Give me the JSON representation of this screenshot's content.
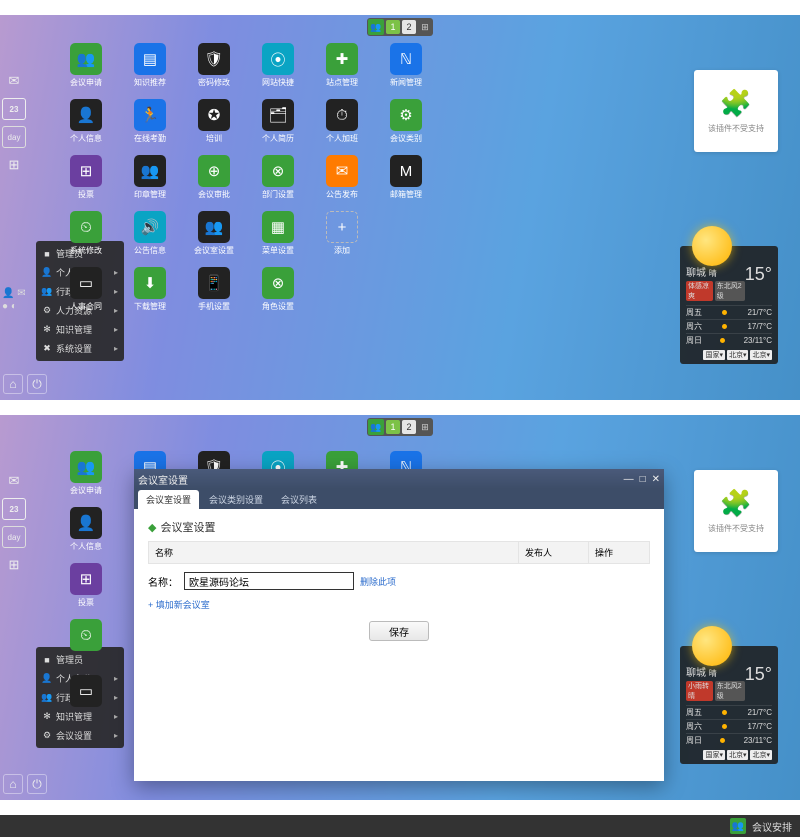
{
  "pager": {
    "pages": [
      "1",
      "2"
    ]
  },
  "sidebar": {
    "calendar": "23",
    "day": "day"
  },
  "startmenu": {
    "items": [
      {
        "icon": "■",
        "label": "管理员",
        "arrow": false
      },
      {
        "icon": "👤",
        "label": "个人办公",
        "arrow": true
      },
      {
        "icon": "👥",
        "label": "行政办公",
        "arrow": true
      },
      {
        "icon": "⚙",
        "label": "人力资源",
        "arrow": true
      },
      {
        "icon": "✻",
        "label": "知识管理",
        "arrow": true
      },
      {
        "icon": "✖",
        "label": "系统设置",
        "arrow": true
      }
    ]
  },
  "startmenu2": {
    "items": [
      {
        "icon": "■",
        "label": "管理员",
        "arrow": false
      },
      {
        "icon": "👤",
        "label": "个人办公",
        "arrow": true
      },
      {
        "icon": "👥",
        "label": "行政办公",
        "arrow": true
      },
      {
        "icon": "✻",
        "label": "知识管理",
        "arrow": true
      },
      {
        "icon": "⚙",
        "label": "会议设置",
        "arrow": true
      }
    ]
  },
  "apps_row1": [
    {
      "c": "c-green",
      "i": "👥",
      "l": "会议申请"
    },
    {
      "c": "c-blue",
      "i": "▤",
      "l": "知识推荐"
    },
    {
      "c": "c-dark",
      "i": "🛡",
      "l": "密码修改"
    },
    {
      "c": "c-teal",
      "i": "⦿",
      "l": "网站快捷"
    },
    {
      "c": "c-green",
      "i": "✚",
      "l": "站点管理"
    },
    {
      "c": "c-blue",
      "i": "ℕ",
      "l": "新闻管理"
    }
  ],
  "apps_row2": [
    {
      "c": "c-dark",
      "i": "👤",
      "l": "个人信息"
    },
    {
      "c": "c-blue",
      "i": "🏃",
      "l": "在线考勤"
    },
    {
      "c": "c-dark",
      "i": "✪",
      "l": "培训"
    },
    {
      "c": "c-dark",
      "i": "🗂",
      "l": "个人简历"
    },
    {
      "c": "c-dark",
      "i": "⏱",
      "l": "个人加班"
    },
    {
      "c": "c-green",
      "i": "⚙",
      "l": "会议类别"
    }
  ],
  "apps_row3": [
    {
      "c": "c-purple",
      "i": "⊞",
      "l": "投票"
    },
    {
      "c": "c-dark",
      "i": "👥",
      "l": "印章管理"
    },
    {
      "c": "c-green",
      "i": "⊕",
      "l": "会议审批"
    },
    {
      "c": "c-green",
      "i": "⊗",
      "l": "部门设置"
    },
    {
      "c": "c-orange",
      "i": "✉",
      "l": "公告发布"
    },
    {
      "c": "c-dark",
      "i": "M",
      "l": "邮箱管理"
    }
  ],
  "apps_row4": [
    {
      "c": "c-green",
      "i": "⏲",
      "l": "系统修改"
    },
    {
      "c": "c-teal",
      "i": "🔊",
      "l": "公告信息"
    },
    {
      "c": "c-dark",
      "i": "👥",
      "l": "会议室设置"
    },
    {
      "c": "c-green",
      "i": "▦",
      "l": "菜单设置"
    },
    {
      "c": "c-border",
      "i": "+",
      "l": "添加"
    }
  ],
  "apps_row5": [
    {
      "c": "c-dark",
      "i": "▭",
      "l": "人事合同"
    },
    {
      "c": "c-green",
      "i": "⬇",
      "l": "下载管理"
    },
    {
      "c": "c-dark",
      "i": "📱",
      "l": "手机设置"
    },
    {
      "c": "c-green",
      "i": "⊗",
      "l": "角色设置"
    }
  ],
  "plugin": {
    "text": "该插件不受支持"
  },
  "weather": {
    "city": "聊城",
    "suffix": "晴",
    "deg": "15°",
    "badge1": "体感凉爽",
    "badge2": "东北风2级",
    "days": [
      {
        "d": "周五",
        "t": "21/7°C"
      },
      {
        "d": "周六",
        "t": "17/7°C"
      },
      {
        "d": "周日",
        "t": "23/11°C"
      }
    ],
    "sel": [
      "国家▾",
      "北京▾",
      "北京▾"
    ]
  },
  "weather2": {
    "badge1": "小雨转晴",
    "badge2": "东北风2级"
  },
  "apps2_r1": [
    {
      "c": "c-green",
      "i": "👥",
      "l": "会议申请"
    },
    {
      "c": "c-blue",
      "i": "▤",
      "l": ""
    },
    {
      "c": "c-dark",
      "i": "🛡",
      "l": ""
    },
    {
      "c": "c-teal",
      "i": "⦿",
      "l": ""
    },
    {
      "c": "c-green",
      "i": "✚",
      "l": ""
    },
    {
      "c": "c-blue",
      "i": "ℕ",
      "l": ""
    }
  ],
  "apps2_r2": [
    {
      "c": "c-dark",
      "i": "👤",
      "l": "个人信息"
    },
    {
      "c": "c-blue",
      "i": "🏃",
      "l": ""
    }
  ],
  "apps2_r3": [
    {
      "c": "c-purple",
      "i": "⊞",
      "l": "投票"
    }
  ],
  "apps2_r4": [
    {
      "c": "c-green",
      "i": "⏲",
      "l": ""
    }
  ],
  "apps2_r5": [
    {
      "c": "c-dark",
      "i": "▭",
      "l": ""
    }
  ],
  "window": {
    "title": "会议室设置",
    "tabs": [
      "会议室设置",
      "会议类别设置",
      "会议列表"
    ],
    "section": "会议室设置",
    "table": {
      "h1": "名称",
      "h2": "发布人",
      "h3": "操作"
    },
    "form": {
      "label": "名称：",
      "value": "欧星源码论坛",
      "del": "删除此项"
    },
    "addlink": "+ 填加新会议室",
    "save": "保存"
  },
  "taskbar": {
    "label": "会议安排"
  }
}
